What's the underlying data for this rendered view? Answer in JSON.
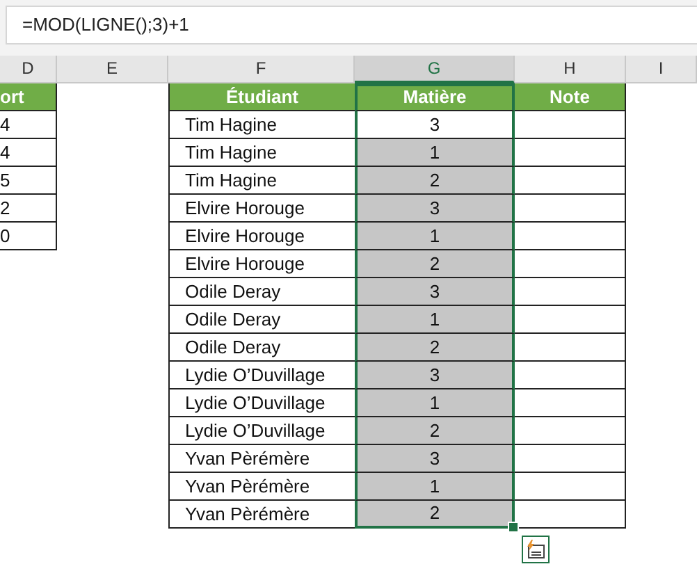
{
  "formula_bar": {
    "value": "=MOD(LIGNE();3)+1"
  },
  "column_headers": [
    {
      "label": "D",
      "selected": false
    },
    {
      "label": "E",
      "selected": false
    },
    {
      "label": "F",
      "selected": false
    },
    {
      "label": "G",
      "selected": true
    },
    {
      "label": "H",
      "selected": false
    },
    {
      "label": "I",
      "selected": false
    }
  ],
  "left_table": {
    "header": "ort",
    "values": [
      "4",
      "4",
      "5",
      "2",
      "0"
    ]
  },
  "main_table": {
    "headers": [
      "Étudiant",
      "Matière",
      "Note"
    ],
    "rows": [
      {
        "student": "Tim Hagine",
        "subject": "3",
        "selected": true,
        "active": true
      },
      {
        "student": "Tim Hagine",
        "subject": "1",
        "selected": true,
        "active": false
      },
      {
        "student": "Tim Hagine",
        "subject": "2",
        "selected": true,
        "active": false
      },
      {
        "student": "Elvire Horouge",
        "subject": "3",
        "selected": true,
        "active": false
      },
      {
        "student": "Elvire Horouge",
        "subject": "1",
        "selected": true,
        "active": false
      },
      {
        "student": "Elvire Horouge",
        "subject": "2",
        "selected": true,
        "active": false
      },
      {
        "student": "Odile Deray",
        "subject": "3",
        "selected": true,
        "active": false
      },
      {
        "student": "Odile Deray",
        "subject": "1",
        "selected": true,
        "active": false
      },
      {
        "student": "Odile Deray",
        "subject": "2",
        "selected": true,
        "active": false
      },
      {
        "student": "Lydie O’Duvillage",
        "subject": "3",
        "selected": true,
        "active": false
      },
      {
        "student": "Lydie O’Duvillage",
        "subject": "1",
        "selected": true,
        "active": false
      },
      {
        "student": "Lydie O’Duvillage",
        "subject": "2",
        "selected": true,
        "active": false
      },
      {
        "student": "Yvan Pèrémère",
        "subject": "3",
        "selected": true,
        "active": false
      },
      {
        "student": "Yvan Pèrémère",
        "subject": "1",
        "selected": true,
        "active": false
      },
      {
        "student": "Yvan Pèrémère",
        "subject": "2",
        "selected": true,
        "active": false
      }
    ]
  }
}
